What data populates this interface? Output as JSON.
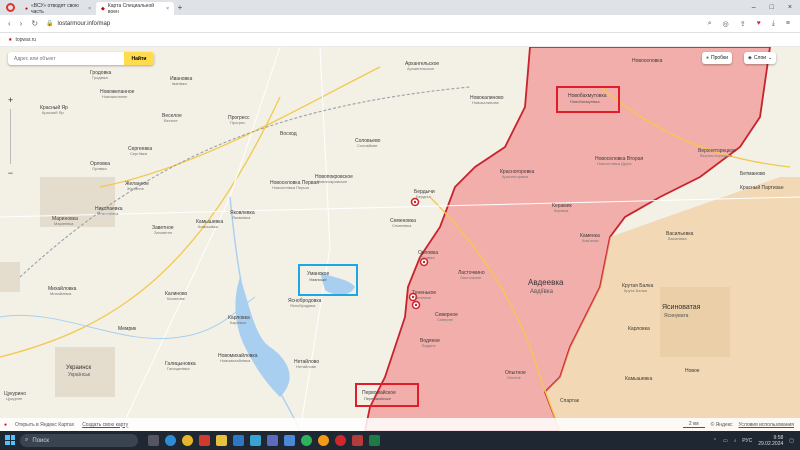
{
  "browser": {
    "tabs": [
      {
        "label": "«ВСУ» отводят свою часть"
      },
      {
        "label": "Карта Специальной воен"
      }
    ],
    "url": "lostarmour.info/map",
    "bookmark": "topwar.ru"
  },
  "search": {
    "placeholder": "Адрес или объект",
    "button": "Найти"
  },
  "controls": {
    "traffic": "Пробки",
    "layers": "Слои",
    "zoom_in": "+",
    "zoom_out": "−"
  },
  "labels": {
    "novogrodovka": "Новогродовка",
    "novogrodovka_ua": "Новогродівка",
    "grodovka": "Гродовка",
    "grodovka_ua": "Гродівка",
    "ivanovka": "Ивановка",
    "ivanovka_ua": "Іванівка",
    "arkhangelskoe": "Архангельское",
    "arkhangelskoe_ua": "Архангельське",
    "novokalinovo": "Новокалиново",
    "novokalinovo_ua": "Новокалинове",
    "novozhelannoe": "Новожеланное",
    "novozhelannoe_ua": "Новожеланне",
    "krasny_yar": "Красный Яр",
    "krasny_yar_ua": "Красний Яр",
    "veseloe": "Веселое",
    "veseloe_ua": "Веселе",
    "progress": "Прогресс",
    "progress_ua": "Прогрес",
    "voskhod": "Восход",
    "solovyovo": "Соловьево",
    "solovyovo_ua": "Соловйове",
    "novobakhmutovka": "Новобахмутовка",
    "novobakhmutovka_ua": "Новобахмутівка",
    "novoselovka": "Новоселовка",
    "novoselovka2": "Новоселовка Вторая",
    "novoselovka2_ua": "Новоселівка Друга",
    "verkhnetoretskoe": "Верхнеторецкое",
    "verkhnetoretskoe_ua": "Верхньоторецьке",
    "orlovka_w": "Орловка",
    "orlovka_w_ua": "Орлівка",
    "sergeevka": "Сергеевка",
    "sergeevka_ua": "Сергіївка",
    "zhelannoe": "Желанное",
    "zhelannoe_ua": "Желанне",
    "novoselovka_perv": "Новоселовка Первая",
    "novoselovka_perv_ua": "Новоселівка Перша",
    "novopokrovskoe": "Новопокровское",
    "novopokrovskoe_ua": "Новопокровське",
    "krasnogorovka": "Красногоровка",
    "krasnogorovka_ua": "Красногорівка",
    "berdychi": "Бердычи",
    "berdychi_ua": "Бердичі",
    "semenovka": "Семеновка",
    "semenovka_ua": "Семенівка",
    "keramik": "Керамик",
    "keramik_ua": "Керамік",
    "kamenka": "Каменка",
    "kamenka_ua": "Кам'янка",
    "yakovlevka": "Яковлевка",
    "yakovlevka_ua": "Яковлівка",
    "betmanovo": "Бетманово",
    "krasny_partizan": "Красный Партизан",
    "vasilyevka": "Васильевка",
    "vasilyevka_ua": "Василівка",
    "marinovka": "Мариновка",
    "marinovka_ua": "Маринівка",
    "nikolaevka": "Николаевка",
    "nikolaevka_ua": "Миколаївка",
    "zavetnoe": "Заветное",
    "zavetnoe_ua": "Заповітне",
    "komyshevka": "Камышевка",
    "komyshevka_ua": "Комишівка",
    "umanskoe": "Уманское",
    "umanskoe_ua": "Уманське",
    "orlovka": "Орловка",
    "orlovka_ua": "Орлівка",
    "lastochkino": "Ласточкино",
    "lastochkino_ua": "Ласточкине",
    "avdeevka": "Авдеевка",
    "avdeevka_ua": "Авдіївка",
    "tonenkoe": "Тоненькое",
    "tonenkoe_ua": "Тоненьке",
    "severnoe": "Северное",
    "severnoe_ua": "Сєверне",
    "mikhailovka": "Михайловка",
    "mikhailovka_ua": "Михайлівка",
    "kalinovo": "Калиново",
    "kalinovo_ua": "Калинове",
    "yasnobrodovka": "Яснобродовка",
    "yasnobrodovka_ua": "Яснобродівка",
    "karlovka": "Карловка",
    "karlovka_ua": "Карлівка",
    "memrik": "Мемрик",
    "vodyanoe": "Водяное",
    "vodyanoe_ua": "Водяне",
    "opytnoe": "Опытное",
    "opytnoe_ua": "Опитне",
    "krutaya_balka": "Крутая Балка",
    "krutaya_balka_ua": "Крута Балка",
    "yasinovataya": "Ясиноватая",
    "yasinovataya_ua": "Ясинувата",
    "ukrainsk": "Украинск",
    "ukrainsk_ua": "Українськ",
    "galitsynovka": "Галицыновка",
    "galitsynovka_ua": "Галицинівка",
    "novomikhailovka": "Новомихайловка",
    "novomikhailovka_ua": "Новомихайлівка",
    "netailovo": "Нетайлово",
    "netailovo_ua": "Нетайлове",
    "pervomaiskoe": "Первомайское",
    "pervomaiskoe_ua": "Первомайське",
    "tsukurino": "Цукурино",
    "tsukurino_ua": "Цукуріне",
    "spartak": "Спартак",
    "kamyshevka": "Камышевка",
    "novoe": "Новое",
    "karlovka2": "Карловка"
  },
  "bottombar": {
    "open": "Открыть в Яндекс Картах",
    "create": "Создать свою карту",
    "yandex": "© Яндекс",
    "terms": "Условия использования",
    "scale": "2 км"
  },
  "taskbar": {
    "search": "Поиск",
    "lang": "РУС",
    "time": "9:58",
    "date": "29.02.2024"
  },
  "colors": {
    "occupied": "#f2aeaa",
    "occupied_border": "#c8232c",
    "frame_red": "#e11d2b",
    "frame_blue": "#1ea7e0",
    "water": "#a9cff0"
  },
  "icons": {
    "back": "back-arrow-icon",
    "forward": "forward-arrow-icon",
    "reload": "reload-icon",
    "lock": "lock-icon",
    "search": "search-icon",
    "windows": "windows-logo-icon"
  }
}
